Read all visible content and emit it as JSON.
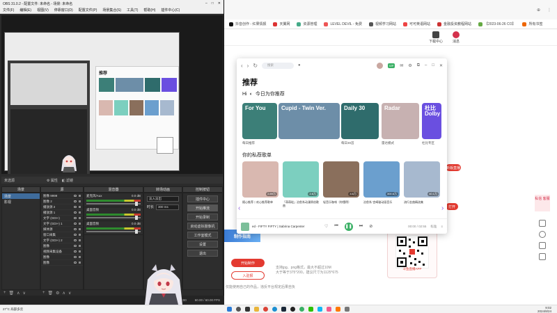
{
  "obs": {
    "title": "OBS 31.0.2 - 配置文件: 未命名 - 场景: 未命名",
    "menu": [
      "文件(F)",
      "编辑(E)",
      "视图(V)",
      "停靠窗口(D)",
      "配置文件(P)",
      "场景集合(S)",
      "工具(T)",
      "帮助(H)",
      "插件中心(C)"
    ],
    "context_bar": {
      "label": "未选源",
      "props": "属性",
      "filters": "滤镜"
    },
    "docks": {
      "scenes": "场景",
      "sources": "源",
      "mixer": "混音器",
      "transitions": "转场动画",
      "controls": "控制按钮"
    },
    "scenes": [
      "场景",
      "影视"
    ],
    "sources": [
      "图像 9999",
      "图像 2",
      "播放源 2",
      "播放源 1",
      "文字 (GDI+)",
      "文字 (GDI+) 1",
      "媒体源",
      "窗口采集",
      "文字 (GDI+) 2",
      "图像",
      "视频采集设备",
      "图像",
      "图像"
    ],
    "mixer": [
      {
        "name": "麦克风/Aux",
        "db": "0.0 dB"
      },
      {
        "name": "桌面音频",
        "db": "0.0 dB"
      },
      {
        "name": "桌面音频",
        "db": "0.0 dB"
      }
    ],
    "transitions": {
      "type": "淡入淡出",
      "duration_label": "时长",
      "duration": "300 ms"
    },
    "controls": [
      "插件中心",
      "开始推流",
      "开始录制",
      "启动虚拟摄像机",
      "工作室模式",
      "设置",
      "退出"
    ],
    "status": {
      "time": "00:00:00",
      "fps": "60.00 / 60.00 FPS"
    }
  },
  "browser": {
    "bookmarks": [
      "抖音创作 - 红果情报",
      "天翼网",
      "资源管理",
      "LEVEL DEVIL - 免费",
      "视频学习网站",
      "可可英语网站",
      "金融投资教程网站",
      "【2023-06-26 CO】",
      "所有书签"
    ],
    "header": {
      "upload": "下载中心",
      "messages": "消息",
      "messages_badge": "99+"
    },
    "create_btn": "开始制作",
    "entry_btn": "入驻报",
    "hint_lines": [
      "支持jpg、png格式，最大不超过10M",
      "大于等于375*200，建议尺寸为1125*675",
      "仅能使用自己的作品，违反平台规定后果自负"
    ],
    "qr_label": "斗鱼直播APP",
    "promo_text": "制作指南",
    "rail_label": "私信 客服",
    "chips": [
      "新版直播",
      "打开"
    ]
  },
  "music": {
    "search_placeholder": "搜索",
    "heading": "推荐",
    "greeting": "Hi",
    "subtitle": "今日为你推荐",
    "cards": [
      {
        "title": "For You",
        "label": "每日推荐",
        "color": "#3c7f78"
      },
      {
        "title": "Cupid - Twin Ver.",
        "label": "",
        "color": "#6d8ea8"
      },
      {
        "title": "Daily 30",
        "label": "每日30首",
        "color": "#2f6c6c"
      },
      {
        "title": "Radar",
        "label": "雷达模式",
        "color": "#c7b1b1"
      },
      {
        "title": "杜比 Dolby",
        "label": "杜比专区",
        "color": "#6a4fe0"
      }
    ],
    "playlists_heading": "你的私荐歌单",
    "playlists": [
      {
        "count": "2.89万",
        "caption": "随心推荐丨欢心推荐歌单",
        "color": "#d9b8b0"
      },
      {
        "count": "2.8万",
        "caption": "「萌萌哒」治愈系动漫原创歌曲",
        "color": "#7ccfbf"
      },
      {
        "count": "4.6万",
        "caption": "轻音乐咖啡（你懂得）",
        "color": "#8a6f5c"
      },
      {
        "count": "300.6万",
        "caption": "治愈系·宫崎骏动画音乐",
        "color": "#6b9fce"
      },
      {
        "count": "40.1万",
        "caption": "流行金曲精选集",
        "color": "#a7b9cf"
      }
    ],
    "player": {
      "song": "ed - FIFTY FIFTY | Sabrina Carpenter",
      "time": "00:00 / 02:55",
      "quality": "标准"
    }
  },
  "taskbar": {
    "weather": "27°C 局部多云",
    "clock_time": "9:02",
    "clock_date": "2024/8/24"
  }
}
